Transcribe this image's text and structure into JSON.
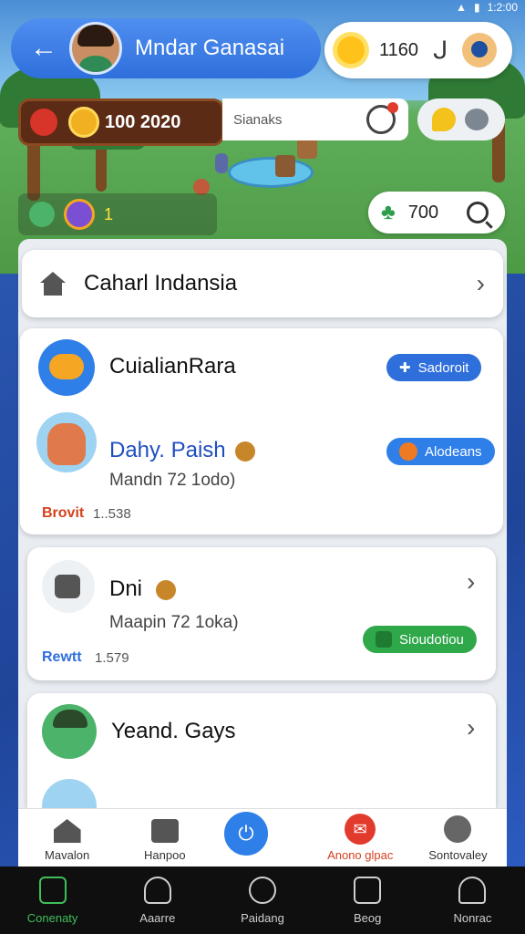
{
  "status_bar": {
    "time": "1:2:00"
  },
  "header": {
    "user_name": "Mndar Ganasai",
    "value": "1160"
  },
  "resources": {
    "coins": "100 2020",
    "search_placeholder": "Sianaks",
    "mini_value": "1",
    "score": "700"
  },
  "home_card": {
    "title": "Caharl Indansia"
  },
  "card1": {
    "title": "CuialianRara",
    "badge1": "Sadoroit",
    "row_title": "Dahy. Paish",
    "badge2": "Alodeans",
    "row_sub": "Mandn 72 1odo)",
    "foot_label": "Brovit",
    "foot_num": "1..538"
  },
  "card2": {
    "title": "Dni",
    "sub": "Maapin 72 1oka)",
    "badge": "Sioudotiou",
    "foot_label": "Rewtt",
    "foot_num": "1.579"
  },
  "card3": {
    "title": "Yeand. Gays"
  },
  "inner_nav": [
    {
      "label": "Mavalon"
    },
    {
      "label": "Hanpoo"
    },
    {
      "label": ""
    },
    {
      "label": "Anono glpac"
    },
    {
      "label": "Sontovaley"
    }
  ],
  "os_nav": [
    {
      "label": "Conenaty"
    },
    {
      "label": "Aaarre"
    },
    {
      "label": "Paidang"
    },
    {
      "label": "Beog"
    },
    {
      "label": "Nonrac"
    }
  ],
  "colors": {
    "accent_blue": "#2f7fe8",
    "coin_bar": "#5b2b16",
    "badge_orange": "#f07a23",
    "badge_green": "#2fa84a",
    "red_label": "#d4411f",
    "blue_label": "#2f6fdc"
  }
}
